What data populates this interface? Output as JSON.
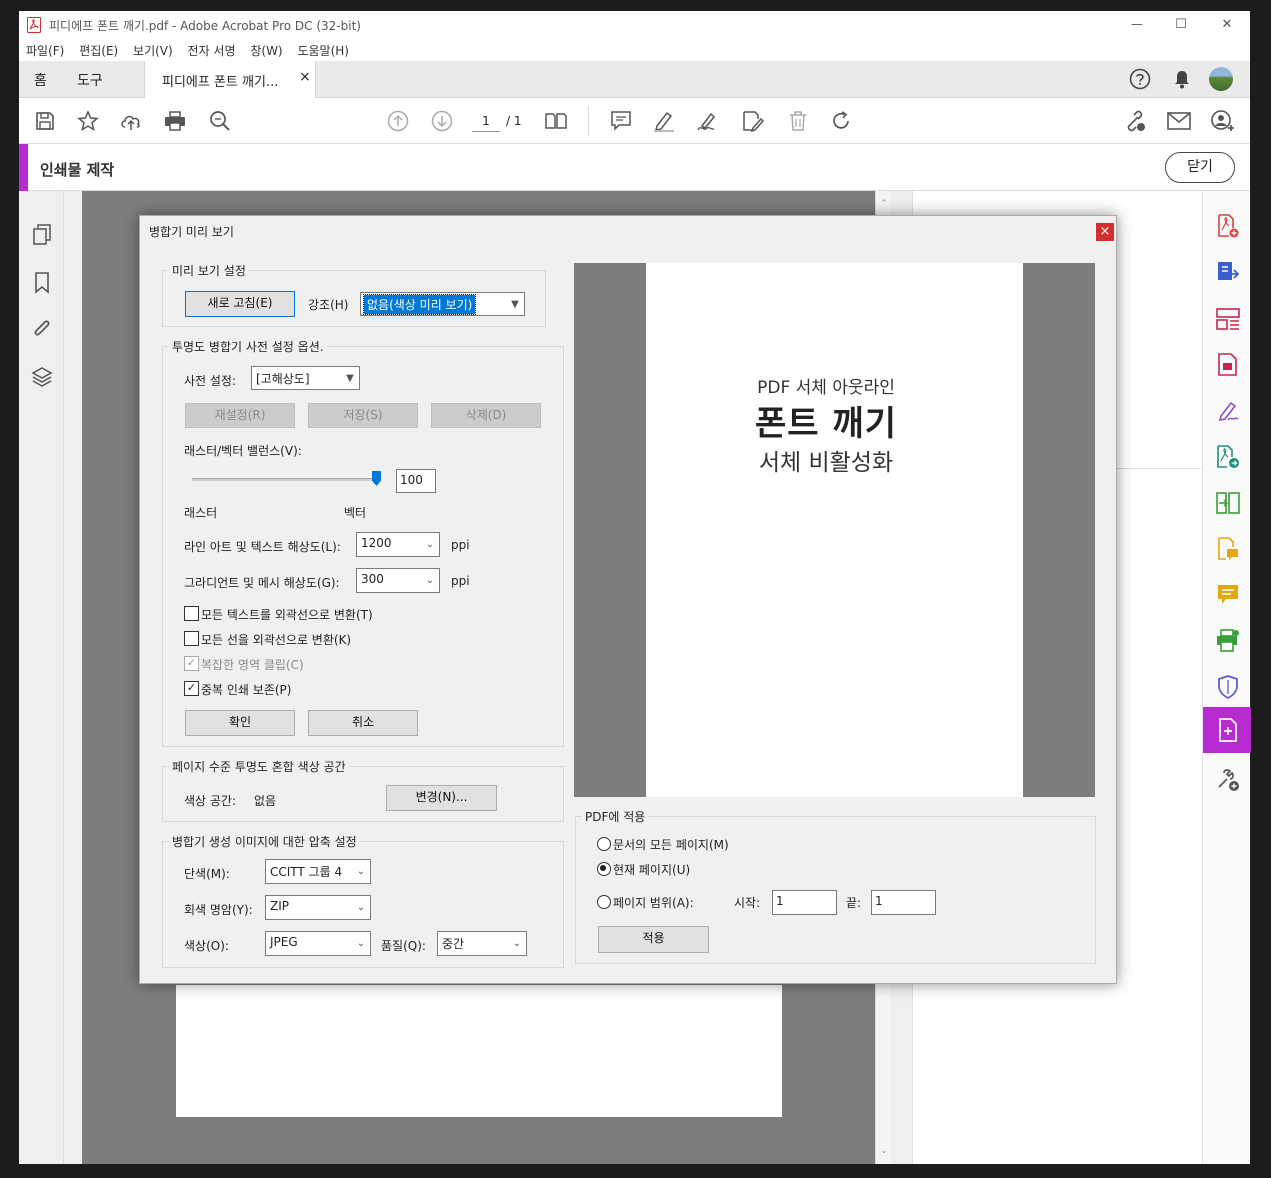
{
  "window": {
    "title": "피디에프 폰트 깨기.pdf - Adobe Acrobat Pro DC (32-bit)",
    "controls": {
      "minimize": "—",
      "maximize": "☐",
      "close": "✕"
    }
  },
  "menu": [
    "파일(F)",
    "편집(E)",
    "보기(V)",
    "전자 서명",
    "창(W)",
    "도움말(H)"
  ],
  "tabs": {
    "home": "홈",
    "tools": "도구",
    "doc": "피디에프 폰트 깨기...",
    "close": "×"
  },
  "toolbar": {
    "page_current": "1",
    "page_total": "/ 1"
  },
  "panel": {
    "title": "인쇄물 제작",
    "close_label": "닫기"
  },
  "dialog": {
    "title": "병합기 미리 보기",
    "close": "×",
    "preview_settings": {
      "legend": "미리 보기 설정",
      "refresh": "새로 고침(E)",
      "highlight_label": "강조(H)",
      "highlight_value": "없음(색상 미리 보기)"
    },
    "flattener": {
      "legend": "투명도 병합기 사전 설정 옵션.",
      "preset_label": "사전 설정:",
      "preset_value": "[고해상도]",
      "reset": "재설정(R)",
      "save": "저장(S)",
      "delete": "삭제(D)",
      "balance_label": "래스터/벡터 밸런스(V):",
      "balance_value": "100",
      "balance_level": 1.0,
      "raster": "래스터",
      "vector": "벡터",
      "line_res_label": "라인 아트 및 텍스트 해상도(L):",
      "line_res_value": "1200",
      "grad_res_label": "그라디언트 및 메시 해상도(G):",
      "grad_res_value": "300",
      "ppi": "ppi",
      "opt1": "모든 텍스트를 외곽선으로 변환(T)",
      "opt2": "모든 선을 외곽선으로 변환(K)",
      "opt3": "복잡한 영역 클립(C)",
      "opt4": "중복 인쇄 보존(P)",
      "ok": "확인",
      "cancel": "취소"
    },
    "blend": {
      "legend": "페이지 수준 투명도 혼합 색상 공간",
      "label": "색상 공간:",
      "value": "없음",
      "change": "변경(N)..."
    },
    "compression": {
      "legend": "병합기 생성 이미지에 대한 압축 설정",
      "mono_label": "단색(M):",
      "mono_value": "CCITT 그룹 4",
      "gray_label": "회색 명암(Y):",
      "gray_value": "ZIP",
      "color_label": "색상(O):",
      "color_value": "JPEG",
      "quality_label": "품질(Q):",
      "quality_value": "중간"
    },
    "preview": {
      "line1": "PDF 서체 아웃라인",
      "line2": "폰트 깨기",
      "line3": "서체 비활성화"
    },
    "apply": {
      "legend": "PDF에 적용",
      "all_pages": "문서의 모든 페이지(M)",
      "current_page": "현재 페이지(U)",
      "range": "페이지 범위(A):",
      "start_label": "시작:",
      "start_value": "1",
      "end_label": "끝:",
      "end_value": "1",
      "apply_btn": "적용"
    }
  },
  "colors": {
    "accent": "#b82bd1",
    "highlight": "#0078d7",
    "close_red": "#d32f2f"
  }
}
